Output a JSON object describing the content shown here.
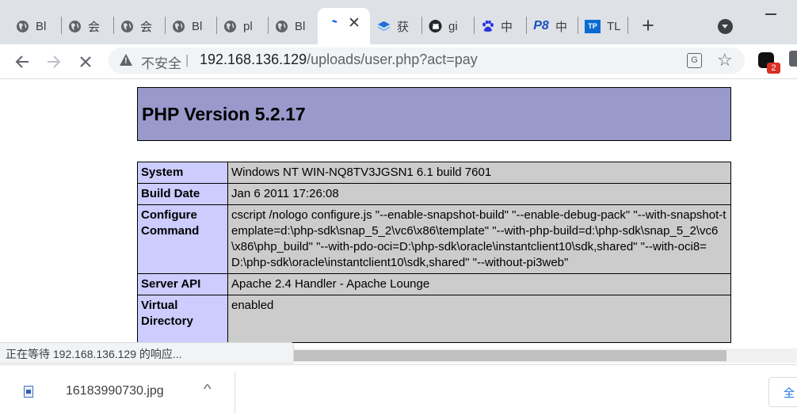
{
  "tabs": [
    {
      "title": "Bl",
      "icon": "globe-icon"
    },
    {
      "title": "会",
      "icon": "globe-icon"
    },
    {
      "title": "会",
      "icon": "globe-icon"
    },
    {
      "title": "Bl",
      "icon": "globe-icon"
    },
    {
      "title": "pl",
      "icon": "globe-icon"
    },
    {
      "title": "Bl",
      "icon": "globe-icon"
    },
    {
      "title": "",
      "icon": "loading-icon",
      "active": true
    },
    {
      "title": "获",
      "icon": "stack-icon"
    },
    {
      "title": "gi",
      "icon": "github-icon"
    },
    {
      "title": "中",
      "icon": "baidu-paw-icon"
    },
    {
      "title": "中",
      "icon": "p8-icon"
    },
    {
      "title": "TL",
      "icon": "tp-icon"
    }
  ],
  "toolbar": {
    "security_label": "不安全",
    "url_host": "192.168.136.129",
    "url_path": "/uploads/user.php?act=pay",
    "extension_badge": "2"
  },
  "page": {
    "header_title": "PHP Version 5.2.17",
    "rows": [
      {
        "key": "System",
        "value": "Windows NT WIN-NQ8TV3JGSN1 6.1 build 7601"
      },
      {
        "key": "Build Date",
        "value": "Jan 6 2011 17:26:08"
      },
      {
        "key": "Configure Command",
        "value": "cscript /nologo configure.js \"--enable-snapshot-build\" \"--enable-debug-pack\" \"--with-snapshot-template=d:\\php-sdk\\snap_5_2\\vc6\\x86\\template\" \"--with-php-build=d:\\php-sdk\\snap_5_2\\vc6\\x86\\php_build\" \"--with-pdo-oci=D:\\php-sdk\\oracle\\instantclient10\\sdk,shared\" \"--with-oci8=D:\\php-sdk\\oracle\\instantclient10\\sdk,shared\" \"--without-pi3web\""
      },
      {
        "key": "Server API",
        "value": "Apache 2.4 Handler - Apache Lounge"
      },
      {
        "key": "Virtual Directory",
        "value": "enabled"
      }
    ]
  },
  "status_bar": {
    "text": "正在等待 192.168.136.129 的响应..."
  },
  "download_shelf": {
    "file_name": "16183990730.jpg",
    "show_all_label": "全"
  },
  "colors": {
    "tabstrip": "#dee1e6",
    "php_header": "#9999cc",
    "php_key_cell": "#ccccff",
    "php_value_cell": "#cccccc"
  }
}
